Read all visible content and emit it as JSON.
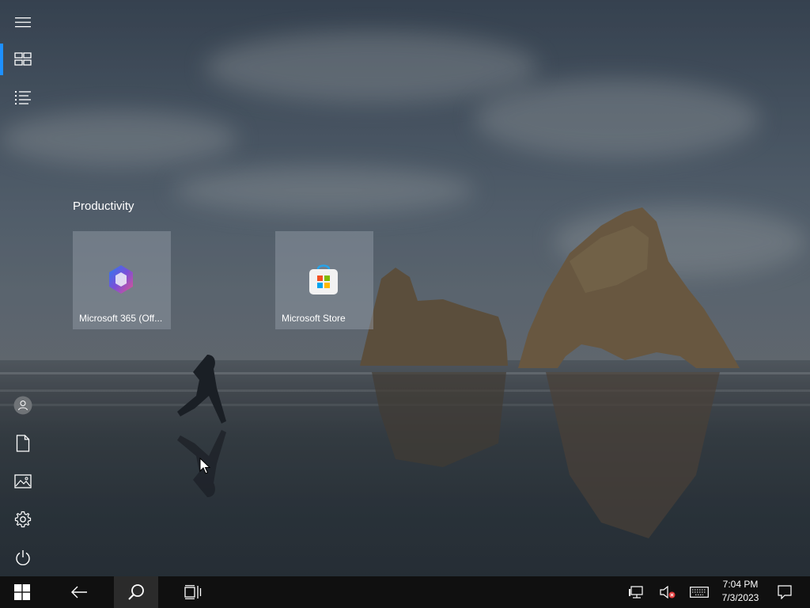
{
  "start_menu": {
    "group_title": "Productivity",
    "tiles": [
      {
        "label": "Microsoft 365 (Off...",
        "icon": "microsoft-365-icon"
      },
      {
        "label": "Microsoft Store",
        "icon": "microsoft-store-icon"
      }
    ],
    "rail_top": [
      {
        "icon": "hamburger-menu-icon",
        "name": "expand-menu"
      },
      {
        "icon": "pinned-tiles-icon",
        "name": "pinned-tiles",
        "active": true
      },
      {
        "icon": "all-apps-list-icon",
        "name": "all-apps"
      }
    ],
    "rail_bottom": [
      {
        "icon": "user-avatar-icon",
        "name": "user-account"
      },
      {
        "icon": "documents-icon",
        "name": "documents"
      },
      {
        "icon": "pictures-icon",
        "name": "pictures"
      },
      {
        "icon": "settings-gear-icon",
        "name": "settings"
      },
      {
        "icon": "power-icon",
        "name": "power"
      }
    ]
  },
  "taskbar": {
    "start_icon": "windows-logo-icon",
    "back_icon": "back-arrow-icon",
    "search_icon": "search-icon",
    "task_view_icon": "task-view-icon",
    "tray": {
      "network_icon": "network-icon",
      "volume_icon": "volume-muted-icon",
      "keyboard_icon": "touch-keyboard-icon",
      "notifications_icon": "action-center-icon"
    },
    "time": "7:04 PM",
    "date": "7/3/2023"
  },
  "colors": {
    "accent": "#1e90ff",
    "taskbar": "#101010",
    "tile": "#8c96a0"
  }
}
